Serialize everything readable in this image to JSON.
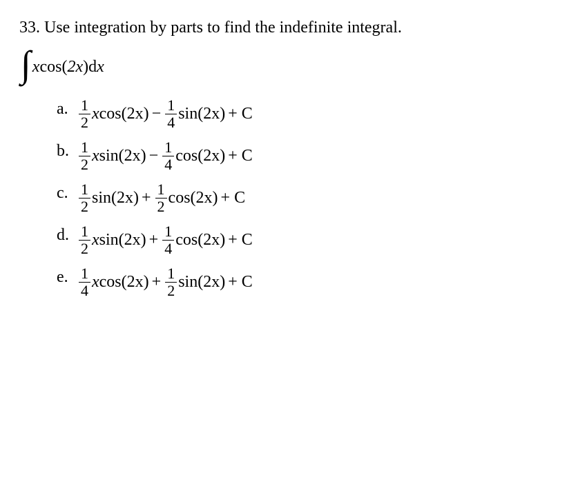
{
  "question": {
    "number": "33.",
    "text": "Use integration by parts to find the indefinite integral."
  },
  "integral": {
    "integrand_html": "x cos(2x) dx"
  },
  "choices": [
    {
      "label": "a.",
      "f1n": "1",
      "f1d": "2",
      "t1": "x",
      "fn1": "cos",
      "arg1": "(2x)",
      "op": "−",
      "f2n": "1",
      "f2d": "4",
      "t2": "",
      "fn2": "sin",
      "arg2": "(2x)",
      "tail": "+ C"
    },
    {
      "label": "b.",
      "f1n": "1",
      "f1d": "2",
      "t1": "x",
      "fn1": "sin",
      "arg1": "(2x)",
      "op": "−",
      "f2n": "1",
      "f2d": "4",
      "t2": "",
      "fn2": "cos",
      "arg2": "(2x)",
      "tail": "+ C"
    },
    {
      "label": "c.",
      "f1n": "1",
      "f1d": "2",
      "t1": "",
      "fn1": "sin",
      "arg1": "(2x)",
      "op": "+",
      "f2n": "1",
      "f2d": "2",
      "t2": "",
      "fn2": "cos",
      "arg2": "(2x)",
      "tail": "+ C"
    },
    {
      "label": "d.",
      "f1n": "1",
      "f1d": "2",
      "t1": "x",
      "fn1": "sin",
      "arg1": "(2x)",
      "op": "+",
      "f2n": "1",
      "f2d": "4",
      "t2": "",
      "fn2": "cos",
      "arg2": "(2x)",
      "tail": "+ C"
    },
    {
      "label": "e.",
      "f1n": "1",
      "f1d": "4",
      "t1": "x",
      "fn1": "cos",
      "arg1": "(2x)",
      "op": "+",
      "f2n": "1",
      "f2d": "2",
      "t2": "",
      "fn2": "sin",
      "arg2": "(2x)",
      "tail": "+ C"
    }
  ]
}
